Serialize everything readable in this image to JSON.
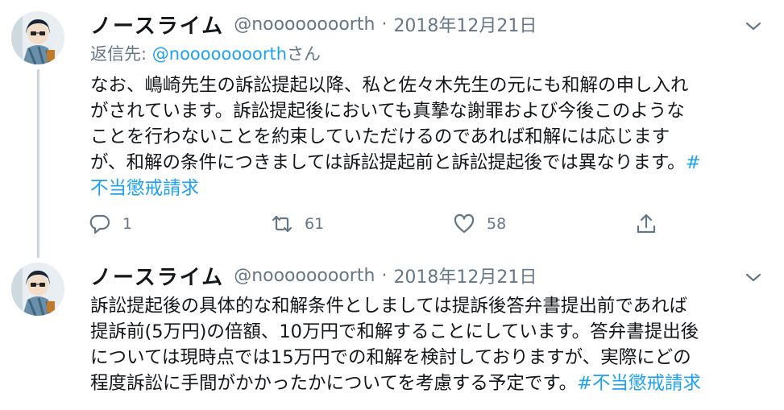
{
  "tweets": [
    {
      "display_name": "ノースライム",
      "handle": "@noooooooorth",
      "separator": "·",
      "date": "2018年12月21日",
      "reply_label": "返信先: ",
      "reply_mention": "@noooooooorth",
      "reply_suffix": "さん",
      "lines": [
        "なお、嶋崎先生の訴訟提起以降、私と佐々木先生の元にも和解の申し入れ",
        "がされています。訴訟提起後においても真摯な謝罪および今後このような",
        "ことを行わないことを約束していただけるのであれば和解には応じます",
        "が、和解の条件につきましては訴訟提起前と訴訟提起後では異なります。"
      ],
      "hashtag_head": "#",
      "hashtag_tail": "不当懲戒請求",
      "replies": "1",
      "retweets": "61",
      "likes": "58"
    },
    {
      "display_name": "ノースライム",
      "handle": "@noooooooorth",
      "separator": "·",
      "date": "2018年12月21日",
      "lines": [
        "訴訟提起後の具体的な和解条件としましては提訴後答弁書提出前であれば",
        "提訴前(5万円)の倍額、10万円で和解することにしています。答弁書提出後",
        "については現時点では15万円での和解を検討しておりますが、実際にどの",
        "程度訴訟に手間がかかったかについてを考慮する予定です。"
      ],
      "hashtag": "#不当懲戒請求"
    }
  ],
  "colors": {
    "accent": "#1da1f2",
    "secondary": "#657786",
    "text": "#14171a",
    "thread": "#ccd6dd"
  },
  "icons": [
    "reply-icon",
    "retweet-icon",
    "like-icon",
    "share-icon",
    "caret-down-icon"
  ]
}
